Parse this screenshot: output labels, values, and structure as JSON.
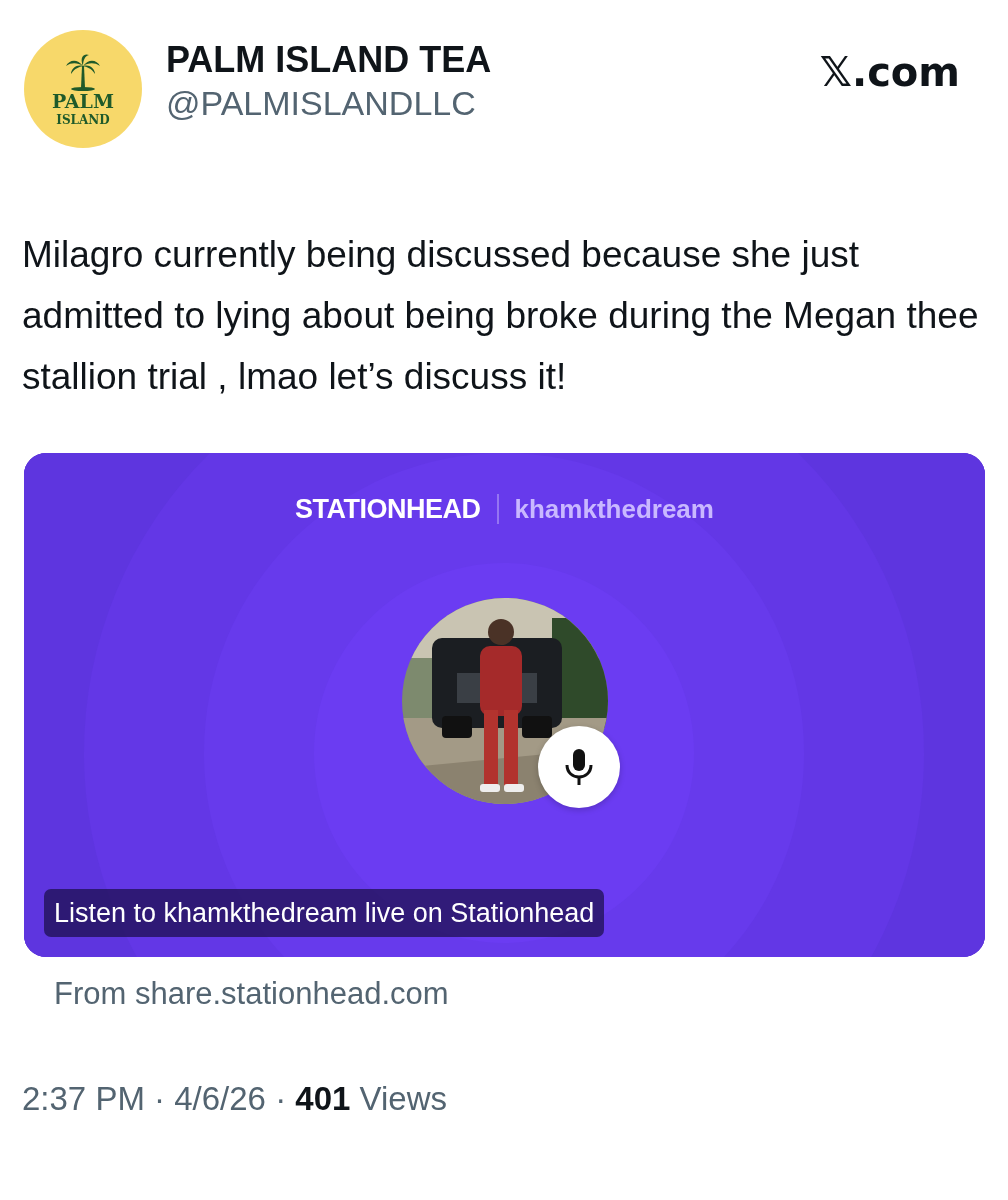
{
  "author": {
    "logo_top": "PALM",
    "logo_bottom": "ISLAND",
    "name": "PALM ISLAND TEA",
    "handle": "@PALMISLANDLLC"
  },
  "site": "𝕏.com",
  "text": "Milagro currently being discussed because she just admitted to lying about being broke during the Megan thee stallion trial , lmao let’s discuss it!",
  "card": {
    "brand": "STATIONHEAD",
    "host": "khamkthedream",
    "caption": "Listen to khamkthedream live on Stationhead"
  },
  "source": "From share.stationhead.com",
  "meta": "2:37 PM · 4/6/26 · **401** Views"
}
